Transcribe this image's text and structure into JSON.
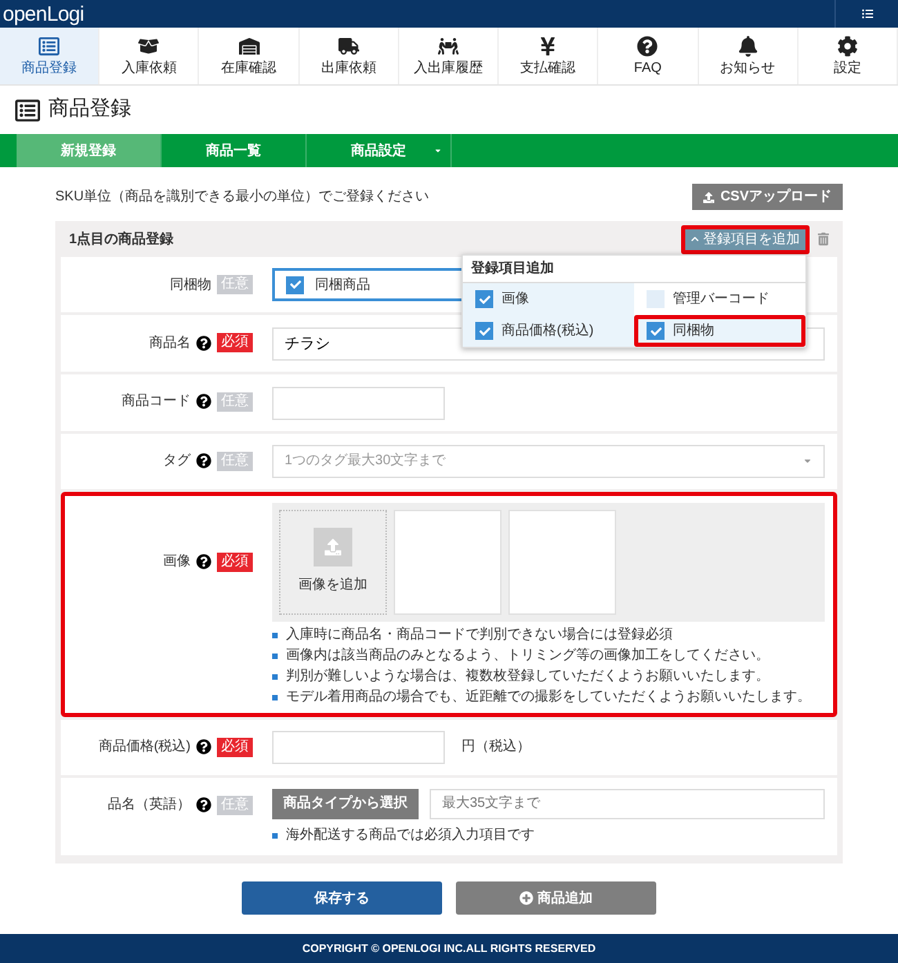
{
  "header": {
    "logo": "openLogi"
  },
  "nav": [
    {
      "label": "商品登録",
      "selected": true
    },
    {
      "label": "入庫依頼",
      "selected": false
    },
    {
      "label": "在庫確認",
      "selected": false
    },
    {
      "label": "出庫依頼",
      "selected": false
    },
    {
      "label": "入出庫履歴",
      "selected": false
    },
    {
      "label": "支払確認",
      "selected": false
    },
    {
      "label": "FAQ",
      "selected": false
    },
    {
      "label": "お知らせ",
      "selected": false
    },
    {
      "label": "設定",
      "selected": false
    }
  ],
  "page_title": "商品登録",
  "tabs": [
    {
      "label": "新規登録",
      "selected": true,
      "has_menu": false
    },
    {
      "label": "商品一覧",
      "selected": false,
      "has_menu": false
    },
    {
      "label": "商品設定",
      "selected": false,
      "has_menu": true
    }
  ],
  "intro": "SKU単位（商品を識別できる最小の単位）でご登録ください",
  "csv_button": "CSVアップロード",
  "card": {
    "title": "1点目の商品登録",
    "add_button": {
      "label": "登録項目を追加",
      "expanded": true,
      "highlighted": true
    }
  },
  "fields": [
    {
      "kind": "checkbox",
      "label": "同梱物",
      "help": false,
      "badge": {
        "kind": "optional",
        "text": "任意"
      },
      "option": "同梱商品",
      "checked": true,
      "highlighted": false
    },
    {
      "kind": "text",
      "label": "商品名",
      "help": true,
      "badge": {
        "kind": "required",
        "text": "必須"
      },
      "value": "チラシ",
      "highlighted": false
    },
    {
      "kind": "short-text",
      "label": "商品コード",
      "help": true,
      "badge": {
        "kind": "optional",
        "text": "任意"
      },
      "highlighted": false
    },
    {
      "kind": "select",
      "label": "タグ",
      "help": true,
      "badge": {
        "kind": "optional",
        "text": "任意"
      },
      "placeholder": "1つのタグ最大30文字まで",
      "highlighted": false
    },
    {
      "kind": "images",
      "label": "画像",
      "help": true,
      "badge": {
        "kind": "required",
        "text": "必須"
      },
      "upload_label": "画像を追加",
      "highlighted": true,
      "notes": [
        "入庫時に商品名・商品コードで判別できない場合には登録必須",
        "画像内は該当商品のみとなるよう、トリミング等の画像加工をしてください。",
        "判別が難しいような場合は、複数枚登録していただくようお願いいたします。",
        "モデル着用商品の場合でも、近距離での撮影をしていただくようお願いいたします。"
      ]
    },
    {
      "kind": "price",
      "label": "商品価格(税込)",
      "help": true,
      "badge": {
        "kind": "required",
        "text": "必須"
      },
      "suffix": "円（税込）",
      "highlighted": false
    },
    {
      "kind": "english-name",
      "label": "品名（英語）",
      "help": true,
      "badge": {
        "kind": "optional",
        "text": "任意"
      },
      "button": "商品タイプから選択",
      "placeholder": "最大35文字まで",
      "highlighted": false,
      "notes": [
        "海外配送する商品では必須入力項目です"
      ]
    }
  ],
  "add_menu": {
    "title": "登録項目追加",
    "options": [
      {
        "label": "画像",
        "checked": true,
        "highlighted": false
      },
      {
        "label": "管理バーコード",
        "checked": false,
        "highlighted": false
      },
      {
        "label": "商品価格(税込)",
        "checked": true,
        "highlighted": false
      },
      {
        "label": "同梱物",
        "checked": true,
        "highlighted": true
      }
    ]
  },
  "buttons": {
    "save": "保存する",
    "add": "商品追加"
  },
  "footer": "COPYRIGHT © OPENLOGI INC.ALL RIGHTS RESERVED"
}
